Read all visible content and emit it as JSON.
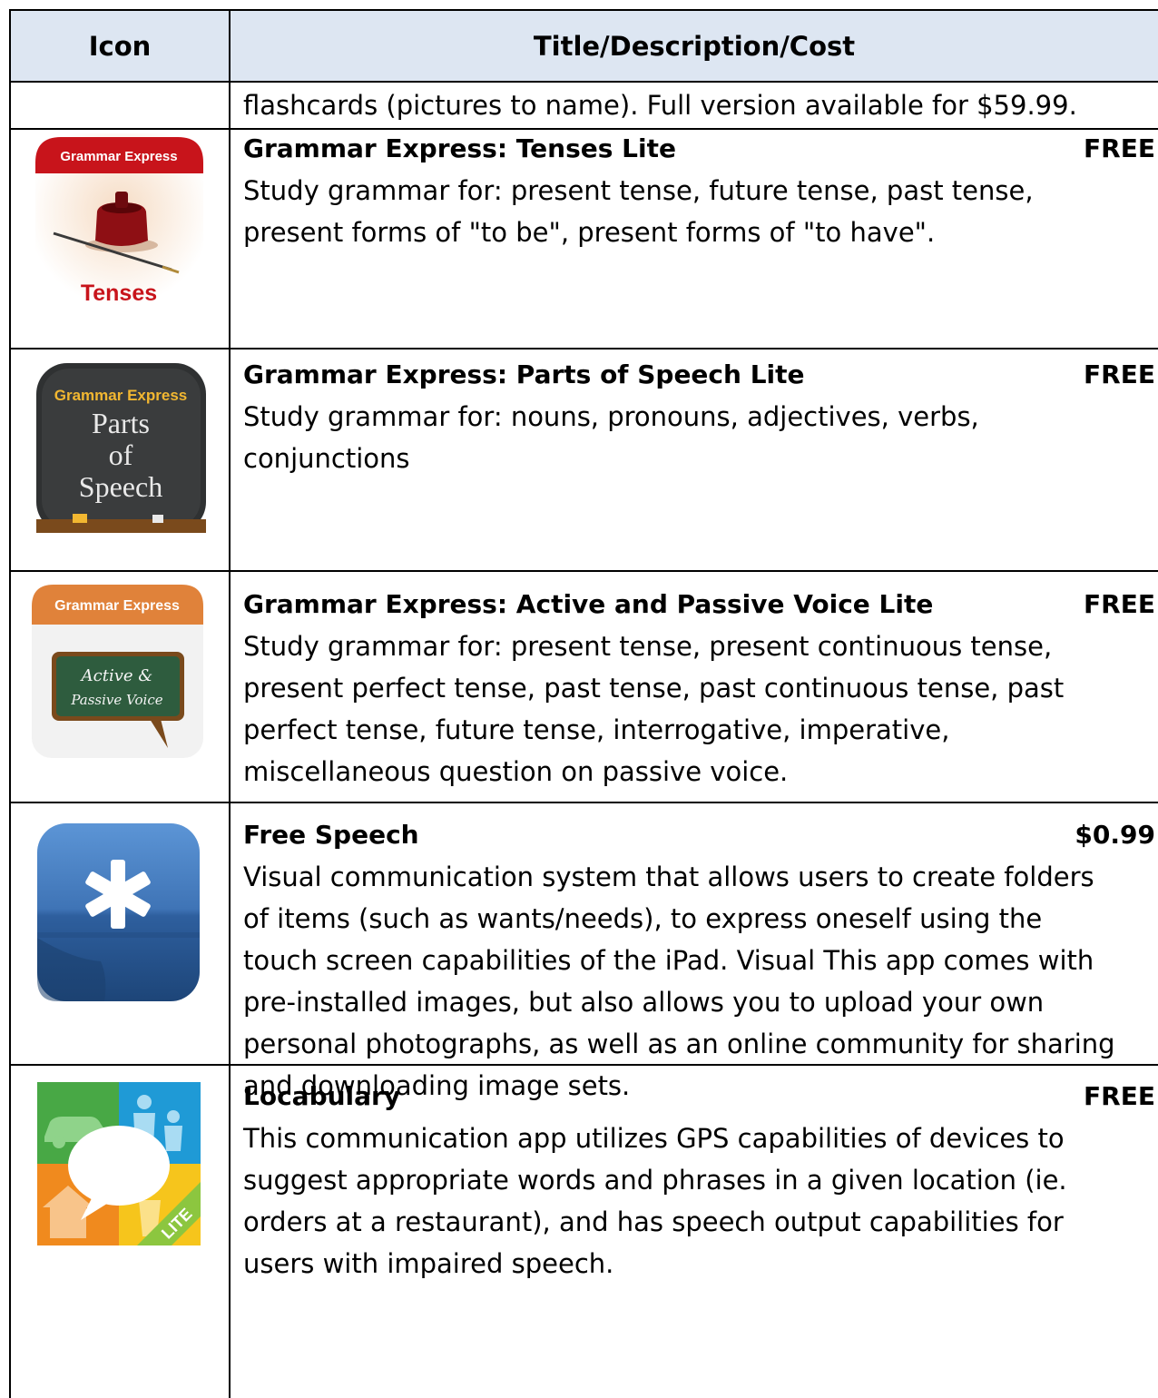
{
  "table": {
    "headers": {
      "icon": "Icon",
      "details": "Title/Description/Cost"
    },
    "continuation": "flashcards (pictures to name).  Full version available for $59.99.",
    "apps": [
      {
        "title": "Grammar Express: Tenses Lite",
        "cost": "FREE",
        "description": [
          "Study grammar for: present tense, future tense, past tense,",
          "present forms of \"to be\", present forms of \"to have\"."
        ],
        "icon_name": "grammar-express-tenses-icon",
        "icon_text": {
          "banner": "Grammar Express",
          "label": "Tenses"
        }
      },
      {
        "title": "Grammar Express: Parts of Speech Lite",
        "cost": "FREE",
        "description": [
          "Study grammar for: nouns, pronouns, adjectives, verbs,",
          "conjunctions"
        ],
        "icon_name": "grammar-express-parts-of-speech-icon",
        "icon_text": {
          "banner": "Grammar Express",
          "line1": "Parts",
          "line2": "of",
          "line3": "Speech"
        }
      },
      {
        "title": "Grammar Express: Active and Passive Voice Lite",
        "cost": "FREE",
        "description": [
          "Study grammar for: present tense, present continuous tense,",
          "present perfect tense, past tense, past continuous tense, past",
          "perfect tense, future tense, interrogative, imperative,",
          "miscellaneous question on passive voice."
        ],
        "icon_name": "grammar-express-active-passive-voice-icon",
        "icon_text": {
          "banner": "Grammar Express",
          "line1": "Active &",
          "line2": "Passive Voice"
        }
      },
      {
        "title": "Free Speech",
        "cost": "$0.99",
        "description": [
          "Visual communication system that allows users to create folders",
          "of items (such as wants/needs), to express oneself using the",
          "touch screen capabilities of the iPad.  Visual This app comes with",
          "pre-installed images, but also allows you to upload your own",
          "personal photographs, as well as an online community for sharing",
          "and downloading image sets."
        ],
        "icon_name": "free-speech-asterisk-bubble-icon"
      },
      {
        "title": "Locabulary",
        "cost": "FREE",
        "description": [
          "This communication app utilizes GPS capabilities of devices to",
          "suggest appropriate words and phrases in a given location (ie.",
          "orders at a restaurant), and has speech output capabilities for",
          "users with impaired speech."
        ],
        "icon_name": "locabulary-lite-icon",
        "icon_text": {
          "badge": "LITE"
        }
      }
    ]
  },
  "colors": {
    "header_bg": "#dde6f2",
    "border": "#000000",
    "tenses_banner": "#c8141b",
    "pos_chalkboard": "#2f3132",
    "active_banner": "#e0823a",
    "free_speech_blue": "#2e5f9e",
    "locabulary_green": "#48a845",
    "locabulary_blue": "#1f9ad6",
    "locabulary_orange": "#f08a1e",
    "locabulary_yellow": "#f6c51c"
  }
}
